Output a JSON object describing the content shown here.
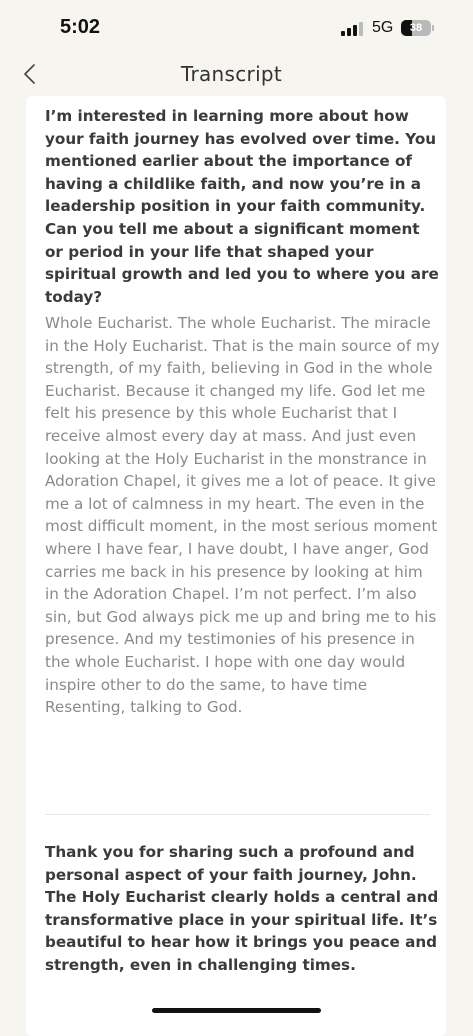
{
  "status_bar": {
    "time": "5:02",
    "network": "5G",
    "battery_level": "38",
    "battery_fraction": 0.38
  },
  "header": {
    "title": "Transcript",
    "back_icon": "chevron-left-icon"
  },
  "transcript": {
    "question": "I’m interested in learning more about how your faith journey has evolved over time. You mentioned earlier about the importance of having a childlike faith, and now you’re in a leadership position in your faith community. Can you tell me about a significant moment or period in your life that shaped your spiritual growth and led you to where you are today?",
    "answer": "Whole Eucharist. The whole Eucharist. The miracle in the Holy Eucharist. That is the main source of my strength, of my faith, believing in God in the whole Eucharist. Because it changed my life. God let me felt his presence by this whole Eucharist that I receive almost every day at mass. And just even looking at the Holy Eucharist in the monstrance in Adoration Chapel, it gives me a lot of peace. It give me a lot of calmness in my heart. The even in the most difficult moment, in the most serious moment where I have fear, I have doubt, I have anger, God carries me back in his presence by looking at him in the Adoration Chapel. I’m not perfect. I’m also sin, but God always pick me up and bring me to his presence. And my testimonies of his presence in the whole Eucharist. I hope with one day would inspire other to do the same, to have time Resenting, talking to God.",
    "reply": "Thank you for sharing such a profound and personal aspect of your faith journey, John. The Holy Eucharist clearly holds a central and transformative place in your spiritual life. It’s beautiful to hear how it brings you peace and strength, even in challenging times."
  },
  "colors": {
    "background": "#f7f5f0",
    "card": "#ffffff",
    "question_text": "#3b3b3b",
    "answer_text": "#8a8a8a"
  }
}
